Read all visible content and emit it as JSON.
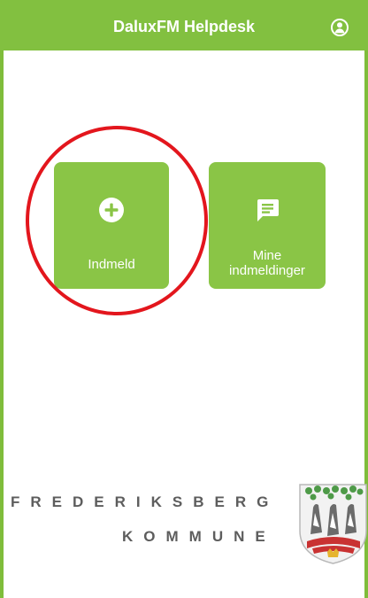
{
  "header": {
    "title": "DaluxFM Helpdesk",
    "account_icon": "user-account-icon"
  },
  "tiles": [
    {
      "label": "Indmeld",
      "icon": "plus-circle-icon"
    },
    {
      "label_lines": [
        "Mine",
        "indmeldinger"
      ],
      "icon": "chat-message-icon"
    }
  ],
  "branding": {
    "line1": "FREDERIKSBERG",
    "line2": "KOMMUNE",
    "crest_icon": "coat-of-arms-icon"
  },
  "colors": {
    "brand_green": "#82c040",
    "tile_green": "#8ac546",
    "highlight_red": "#e3161d",
    "text_gray": "#5d5d5d"
  }
}
